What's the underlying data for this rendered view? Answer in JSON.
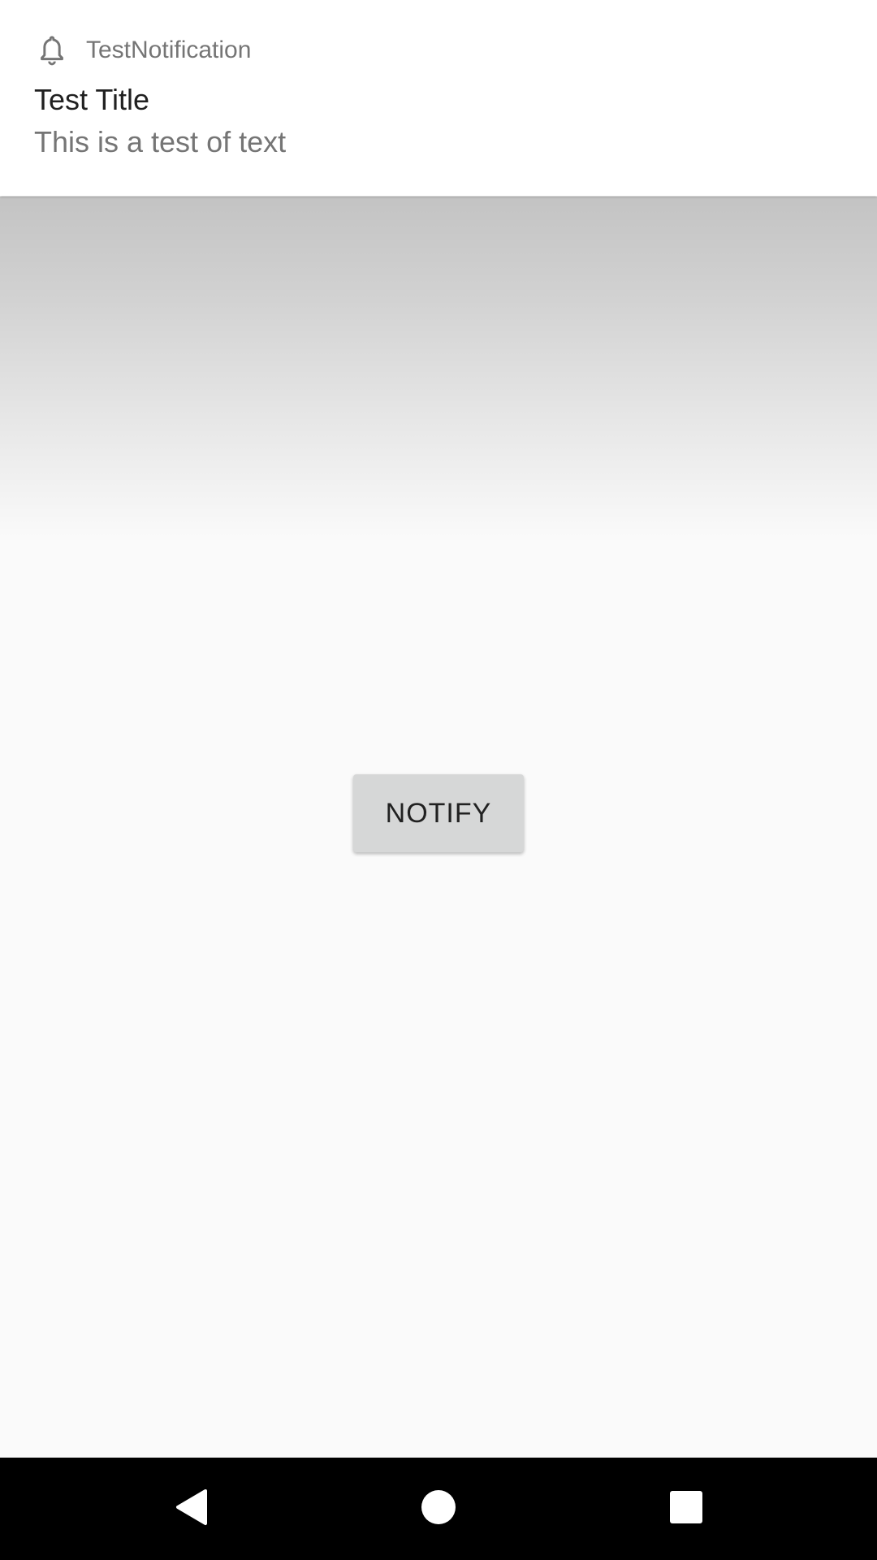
{
  "notification": {
    "app_name": "TestNotification",
    "title": "Test Title",
    "text": "This is a test of text",
    "icon": "bell-icon"
  },
  "main": {
    "notify_button_label": "NOTIFY"
  },
  "nav_bar": {
    "back_icon": "back-triangle-icon",
    "home_icon": "home-circle-icon",
    "recents_icon": "recents-square-icon"
  },
  "colors": {
    "background": "#fafafa",
    "button": "#d6d7d7",
    "nav_bar": "#000000",
    "notification_bg": "#ffffff",
    "secondary_text": "#757575",
    "primary_text": "#212121"
  }
}
